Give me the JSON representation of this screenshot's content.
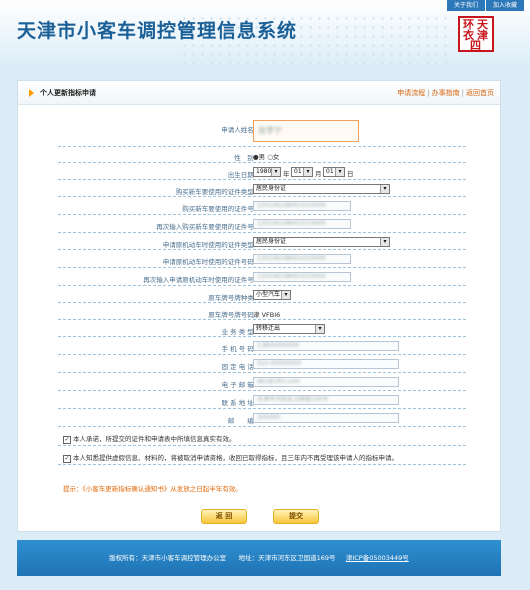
{
  "header": {
    "title": "天津市小客车调控管理信息系统",
    "links": [
      "关于我们",
      "加入收藏"
    ],
    "seal_chars": [
      "天",
      "津",
      "环",
      "衣",
      "四"
    ]
  },
  "panel": {
    "title": "个人更新指标申请",
    "links": [
      "申请流程",
      "办事指南",
      "返回首页"
    ]
  },
  "form": {
    "applicant_name_label": "申请人姓名:",
    "applicant_name_value": "张李宁",
    "gender_label": "性　别:",
    "gender_options": [
      "男",
      "女"
    ],
    "gender_selected": "男",
    "birth_label": "出生日期:",
    "birth_year": "1980",
    "birth_year_unit": "年",
    "birth_month": "01",
    "birth_month_unit": "月",
    "birth_day": "01",
    "birth_day_unit": "日",
    "buyer_id_type_label": "购买新车要使用的证件类型:",
    "buyer_id_type_value": "居民身份证",
    "buyer_id_no_label": "购买新车要使用的证件号:",
    "buyer_id_no_value": "120106198001010000",
    "buyer_id_no_repeat_label": "再次输入购买新车要使用的证件号:",
    "buyer_id_no_repeat_value": "120106198001010000",
    "orig_id_type_label": "申请原机动车时使用的证件类型:",
    "orig_id_type_value": "居民身份证",
    "orig_id_no_label": "申请原机动车时使用的证件号码:",
    "orig_id_no_value": "120106198001010000",
    "orig_id_no_repeat_label": "再次输入申请原机动车时使用的证件号:",
    "orig_id_no_repeat_value": "120106198001010000",
    "plate_type_label": "原车牌号牌种类:",
    "plate_type_value": "小型汽车",
    "plate_no_label": "原车牌号牌号码:",
    "plate_no_value": "津 VFBI6",
    "business_type_label": "业 务 类 型:",
    "business_type_value": "转移迁出",
    "mobile_label": "手 机 号 码:",
    "mobile_value": "13800000000",
    "phone_label": "固 定 电 话:",
    "phone_value": "022-00000000",
    "email_label": "电 子 邮 箱:",
    "email_value": "abc@163.com",
    "address_label": "联 系 地 址:",
    "address_value": "天津市河东区卫国道100号",
    "zip_label": "邮　　编:",
    "zip_value": "300000"
  },
  "agreements": [
    "本人承诺，所提交的证件和申请表中所填信息真实有效。",
    "本人知悉提供虚假信息、材料的，将被取消申请资格，收回已取得指标，且三年内不再受理该申请人的指标申请。"
  ],
  "hint": "提示：《小客车更新指标确认通知书》从发放之日起半年有效。",
  "buttons": {
    "back": "返 回",
    "submit": "提交"
  },
  "footer": {
    "copyright_label": "版权所有：",
    "copyright_value": "天津市小客车调控管理办公室",
    "address_label": "地址：",
    "address_value": "天津市河东区卫国道169号",
    "icp": "津ICP备05003449号"
  }
}
